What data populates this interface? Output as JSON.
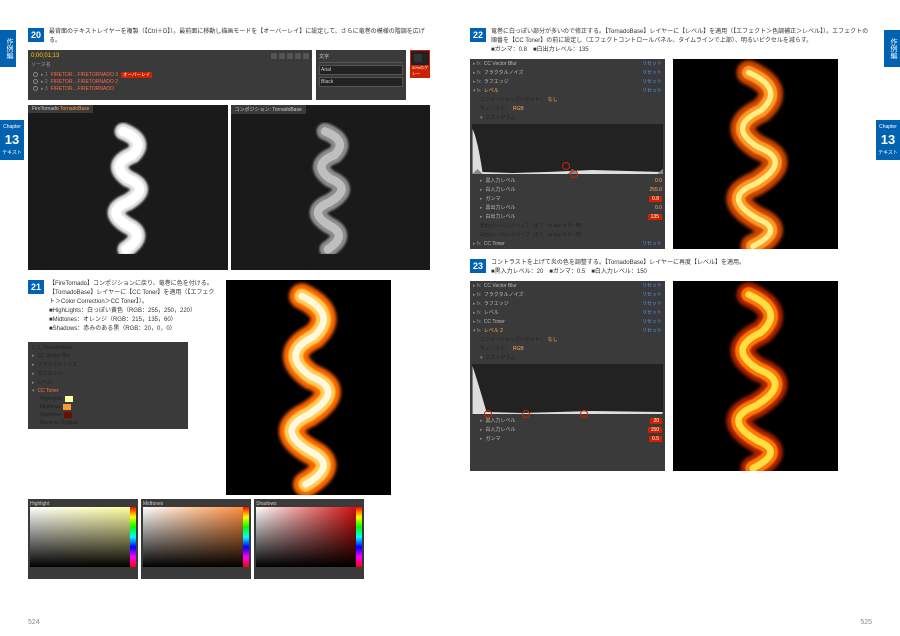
{
  "sidetab": "作例編",
  "chapter": {
    "label": "Chapter",
    "num": "13",
    "sub": "テキスト"
  },
  "pages": {
    "left": "524",
    "right": "525"
  },
  "step20": {
    "num": "20",
    "text": "最背面のテキストレイヤーを複製（【Ctrl＋D】）。最前面に移動し描画モードを【オーバーレイ】に設定して、さらに竜巻の模様の階調を広げる。",
    "playhead": "0;00;01;13",
    "source": "ソース名",
    "layers": [
      "FIRETOR…FIRETORNADO 3",
      "FIRETOR…FIRETORNADO 2",
      "FIRETOR…FIRETORNADO"
    ],
    "overlay": "オーバーレイ",
    "textTab": "文字",
    "font": "Arial",
    "style": "Black",
    "pct": "50%のグレー",
    "viewL": "FireTornado",
    "viewL2": "TornadoBase",
    "viewR": "コンポジション: TornadoBase",
    "viewR2": "TornadoBase"
  },
  "step21": {
    "num": "21",
    "text": "【FireTornado】コンポジションに戻り、竜巻に色を付ける。【TornadoBase】レイヤーに【CC Toner】を適用（【エフェクト＞Color Correction＞CC Toner】）。",
    "hl": "■HighLights：白っぽい黄色（RGB：255，250，220）",
    "mid": "■Midtones：オレンジ（RGB：215，135，60）",
    "sh": "■Shadows：赤みのある黒（RGB：20，0，0）",
    "panel": {
      "title": "1_1_TornadoBase",
      "fx": [
        "CC Vector Blur",
        "フラクタルノイズ",
        "ラフエッジ",
        "レベル"
      ],
      "ccToner": "CC Toner",
      "items": [
        "Highlights",
        "Midtones",
        "Shadows",
        "Blend w. Original"
      ]
    },
    "pickers": [
      "Highlight",
      "Midtones",
      "Shadows"
    ]
  },
  "step22": {
    "num": "22",
    "text": "竜巻に白っぽい部分が多いので修正する。【TornadoBase】レイヤーに【レベル】を適用（【エフェクト＞色調補正＞レベル】）。エフェクトの順番を【CC Toner】の前に設定し（エフェクトコントロールパネル、タイムラインで上部）、明るいピクセルを減らす。",
    "text2": "■ガンマ：0.8　■白出力レベル：135",
    "fx": [
      "CC Vector Blur",
      "フラクタルノイズ",
      "ラフエッジ",
      "レベル"
    ],
    "anim": "アニメーションプリセット：",
    "none": "なし",
    "channel": "チャンネル：",
    "rgb": "RGB",
    "histo": "ヒストグラム",
    "params": [
      {
        "l": "黒入力レベル",
        "v": "0.0"
      },
      {
        "l": "白入力レベル",
        "v": "255.0"
      },
      {
        "l": "ガンマ",
        "v": "0.8",
        "red": true
      },
      {
        "l": "黒出力レベル",
        "v": "0.0"
      },
      {
        "l": "白出力レベル",
        "v": "135",
        "red": true
      }
    ],
    "clip1": "黒出力レベルにクリップ（オフ：32 bpc カラー用）",
    "clip2": "白出力レベルにクリップ（オフ：32 bpc カラー用）",
    "ccToner": "CC Toner",
    "reset": "リセット"
  },
  "step23": {
    "num": "23",
    "text": "コントラストを上げて炎の色を調整する。【TornadoBase】レイヤーに再度【レベル】を適用。",
    "text2": "■黒入力レベル：20　■ガンマ：0.5　■白入力レベル：150",
    "fx": [
      "CC Vector Blur",
      "フラクタルノイズ",
      "ラフエッジ",
      "レベル",
      "CC Toner",
      "レベル 2"
    ],
    "anim": "アニメーションプリセット：",
    "none": "なし",
    "channel": "チャンネル：",
    "rgb": "RGB",
    "histo": "ヒストグラム",
    "params": [
      {
        "l": "黒入力レベル",
        "v": "20",
        "red": true
      },
      {
        "l": "白入力レベル",
        "v": "150",
        "red": true
      },
      {
        "l": "ガンマ",
        "v": "0.5",
        "red": true
      }
    ],
    "reset": "リセット"
  }
}
